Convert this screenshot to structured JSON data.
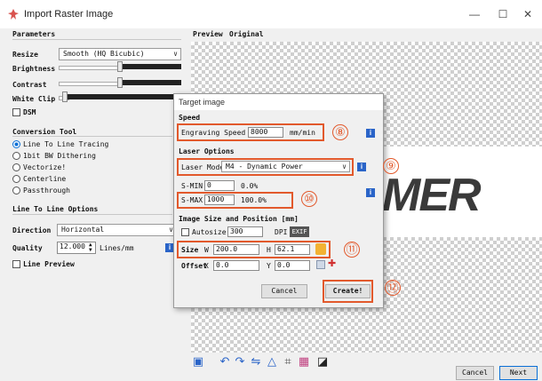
{
  "window": {
    "title": "Import Raster Image",
    "controls": {
      "minimize": "—",
      "maximize": "☐",
      "close": "✕"
    }
  },
  "params": {
    "header": "Parameters",
    "resize_label": "Resize",
    "resize_value": "Smooth (HQ Bicubic)",
    "brightness_label": "Brightness",
    "contrast_label": "Contrast",
    "white_clip_label": "White Clip",
    "dsm_label": "DSM"
  },
  "conversion": {
    "header": "Conversion Tool",
    "options": [
      "Line To Line Tracing",
      "1bit BW Dithering",
      "Vectorize!",
      "Centerline",
      "Passthrough"
    ],
    "selected": "Line To Line Tracing"
  },
  "line_options": {
    "header": "Line To Line Options",
    "direction_label": "Direction",
    "direction_value": "Horizontal",
    "quality_label": "Quality",
    "quality_value": "12.000",
    "quality_unit": "Lines/mm",
    "line_preview_label": "Line Preview"
  },
  "tabs": [
    "Preview",
    "Original"
  ],
  "preview_logo_text": "MER",
  "dialog": {
    "title": "Target image",
    "speed_header": "Speed",
    "engraving_speed_label": "Engraving Speed",
    "engraving_speed_value": "8000",
    "engraving_speed_unit": "mm/min",
    "laser_header": "Laser Options",
    "laser_mode_label": "Laser Mode",
    "laser_mode_value": "M4 - Dynamic Power",
    "smin_label": "S-MIN",
    "smin_value": "0",
    "smin_pct": "0.0%",
    "smax_label": "S-MAX",
    "smax_value": "1000",
    "smax_pct": "100.0%",
    "size_header": "Image Size and Position [mm]",
    "autosize_label": "Autosize",
    "autosize_value": "300",
    "dpi_label": "DPI",
    "exif_label": "EXIF",
    "size_label": "Size",
    "w_label": "W",
    "w_value": "200.0",
    "h_label": "H",
    "h_value": "62.1",
    "offset_label": "Offset",
    "x_label": "X",
    "x_value": "0.0",
    "y_label": "Y",
    "y_value": "0.0",
    "cancel_label": "Cancel",
    "create_label": "Create!"
  },
  "callouts": {
    "c8": "⑧",
    "c9": "⑨",
    "c10": "⑩",
    "c11": "⑪",
    "c12": "⑫"
  },
  "footer": {
    "cancel_label": "Cancel",
    "next_label": "Next"
  },
  "colors": {
    "accent": "#e2592c",
    "info_blue": "#2a64c8",
    "radio_blue": "#0a6fd6"
  }
}
